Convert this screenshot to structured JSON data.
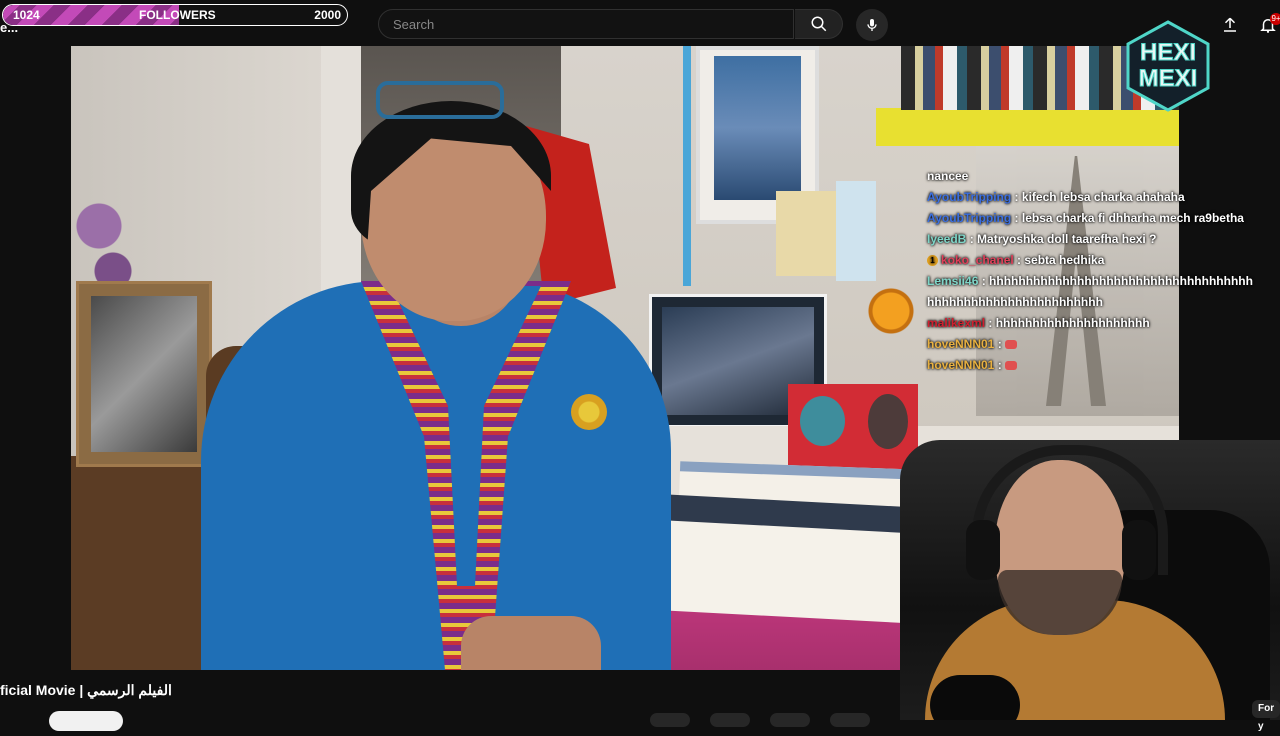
{
  "followers_goal": {
    "current": "1024",
    "label": "FOLLOWERS",
    "goal": "2000",
    "progress_fraction": 0.512,
    "bar_color": "#c34ab8"
  },
  "channel_name_partial": "e...",
  "search": {
    "placeholder": "Search",
    "icon": "search-icon",
    "voice_icon": "mic-icon"
  },
  "header_actions": {
    "upload_icon": "upload-icon",
    "notifications_icon": "bell-icon",
    "notification_badge": "9+"
  },
  "logo": {
    "line1": "HEXI",
    "line2": "MEXI",
    "color": "#4fd6c8"
  },
  "chat": {
    "messages": [
      {
        "user": "",
        "text": "nancee",
        "user_color": "#ffffff"
      },
      {
        "user": "AyoubTripping",
        "text": "kifech lebsa charka ahahaha",
        "user_color": "#3b6fe0"
      },
      {
        "user": "AyoubTripping",
        "text": "lebsa charka fi dhharha mech ra9betha",
        "user_color": "#3b6fe0"
      },
      {
        "user": "IyeedB",
        "text": "Matryoshka doll taarefha hexi ?",
        "user_color": "#7ed6c8"
      },
      {
        "user": "koko_chanel",
        "text": "sebta hedhika",
        "user_color": "#e0405a",
        "badge": "1"
      },
      {
        "user": "Lemsii46",
        "text": "hhhhhhhhhhhhhhhhhhhhhhhhhhhhhhhhhhhhhhhhhhhhhhhhhhhhhhhhhhhh",
        "user_color": "#7ed6c8"
      },
      {
        "user": "malikexml",
        "text": "hhhhhhhhhhhhhhhhhhhhh",
        "user_color": "#d02030"
      },
      {
        "user": "hoveNNN01",
        "text": "",
        "user_color": "#e8b040",
        "emote": "emote-icon"
      },
      {
        "user": "hoveNNN01",
        "text": "",
        "user_color": "#e8b040",
        "emote": "emote-icon"
      }
    ]
  },
  "video_title": "ficial Movie | الفيلم الرسمي",
  "for_you_chip": "For y"
}
